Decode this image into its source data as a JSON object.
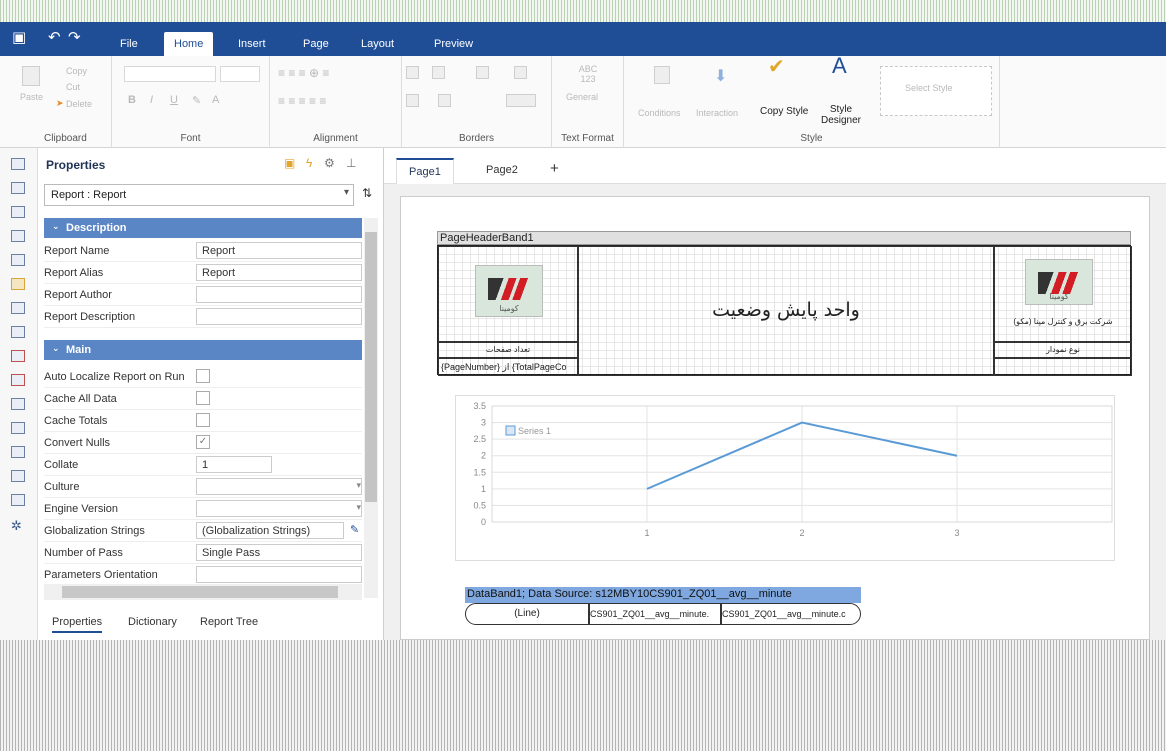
{
  "titlebar": {
    "tabs": [
      "File",
      "Home",
      "Insert",
      "Page",
      "Layout",
      "Preview"
    ],
    "active_tab": "Home"
  },
  "ribbon": {
    "clipboard": {
      "label": "Clipboard",
      "paste": "Paste",
      "copy": "Copy",
      "cut": "Cut",
      "delete": "Delete"
    },
    "font": {
      "label": "Font"
    },
    "alignment": {
      "label": "Alignment"
    },
    "borders": {
      "label": "Borders"
    },
    "textformat": {
      "label": "Text Format",
      "general": "General",
      "sample": "ABC 123"
    },
    "style": {
      "label": "Style",
      "conditions": "Conditions",
      "interaction": "Interaction",
      "copy_style": "Copy Style",
      "style_designer": "Style Designer"
    },
    "select_style": "Select Style"
  },
  "properties": {
    "title": "Properties",
    "object": "Report : Report",
    "categories": {
      "description": "Description",
      "main": "Main"
    },
    "description_rows": [
      {
        "name": "Report Name",
        "value": "Report"
      },
      {
        "name": "Report Alias",
        "value": "Report"
      },
      {
        "name": "Report Author",
        "value": ""
      },
      {
        "name": "Report Description",
        "value": ""
      }
    ],
    "main_rows": {
      "auto_localize": "Auto Localize Report on Run",
      "cache_all": "Cache All Data",
      "cache_totals": "Cache Totals",
      "convert_nulls": "Convert Nulls",
      "collate": "Collate",
      "collate_value": "1",
      "culture": "Culture",
      "engine_version": "Engine Version",
      "globalization": "Globalization Strings",
      "globalization_value": "(Globalization Strings)",
      "number_of_pass": "Number of Pass",
      "number_of_pass_value": "Single Pass",
      "parameters_orientation": "Parameters Orientation"
    },
    "bottom_tabs": [
      "Properties",
      "Dictionary",
      "Report Tree"
    ]
  },
  "pagetabs": [
    "Page1",
    "Page2",
    "+"
  ],
  "report": {
    "band_title": "PageHeaderBand1",
    "title_fa": "واحد پایش وضعیت",
    "logo_word": "کومینا",
    "pages_label": "تعداد صفحات",
    "page_expr": "{PageNumber} از {TotalPageCo",
    "company": "شرکت برق و کنترل مپنا (مکو)",
    "chart_type": "نوع نمودار",
    "databand_title": "DataBand1; Data Source: s12MBY10CS901_ZQ01__avg__minute",
    "databand_cells": [
      "(Line)",
      "CS901_ZQ01__avg__minute.",
      "CS901_ZQ01__avg__minute.c"
    ]
  },
  "chart_data": {
    "type": "line",
    "x": [
      1,
      2,
      3
    ],
    "series": [
      {
        "name": "Series 1",
        "values": [
          1,
          3,
          2
        ]
      }
    ],
    "y_ticks": [
      "0",
      "0.5",
      "1",
      "1.5",
      "2",
      "2.5",
      "3",
      "3.5"
    ],
    "x_ticks": [
      "1",
      "2",
      "3"
    ],
    "ylim": [
      0,
      3.5
    ],
    "xlim": [
      0,
      4
    ],
    "colors": {
      "line": "#5b9bd5"
    }
  }
}
